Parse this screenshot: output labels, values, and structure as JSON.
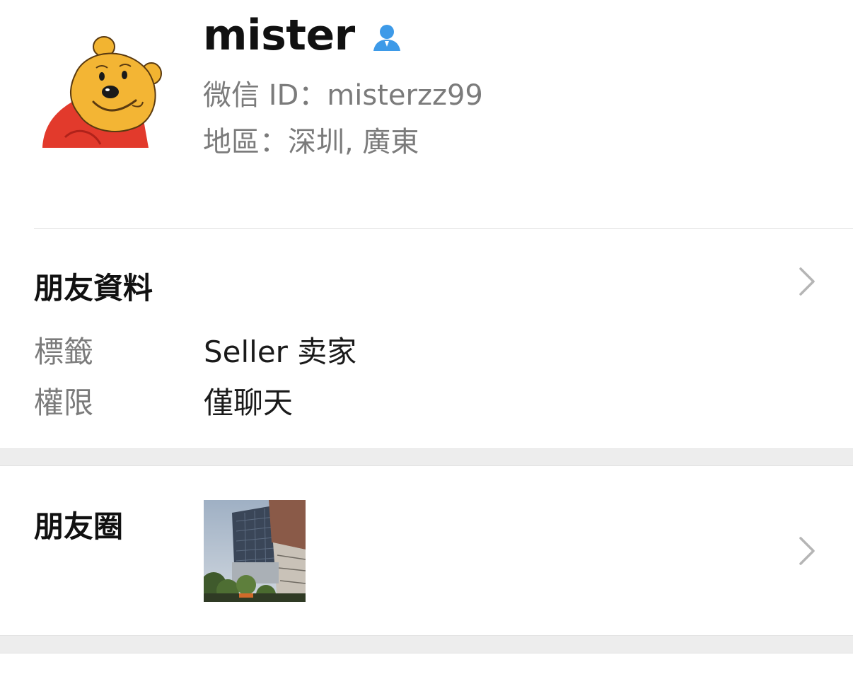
{
  "profile": {
    "name": "mister",
    "wechat_id_line": "微信 ID：misterzz99",
    "region_line": "地區：深圳, 廣東",
    "avatar_icon": "winnie-the-pooh-avatar",
    "contact_icon": "contact-person-icon",
    "contact_icon_color": "#3d9ae8"
  },
  "friend_info": {
    "title": "朋友資料",
    "rows": [
      {
        "label": "標籤",
        "value": "Seller 卖家"
      },
      {
        "label": "權限",
        "value": "僅聊天"
      }
    ]
  },
  "moments": {
    "title": "朋友圈",
    "thumbnail": "building-photo-thumbnail"
  },
  "colors": {
    "background": "#ffffff",
    "section_gap": "#ededed",
    "secondary_text": "#7b7b7b",
    "chevron": "#b5b5b5"
  }
}
